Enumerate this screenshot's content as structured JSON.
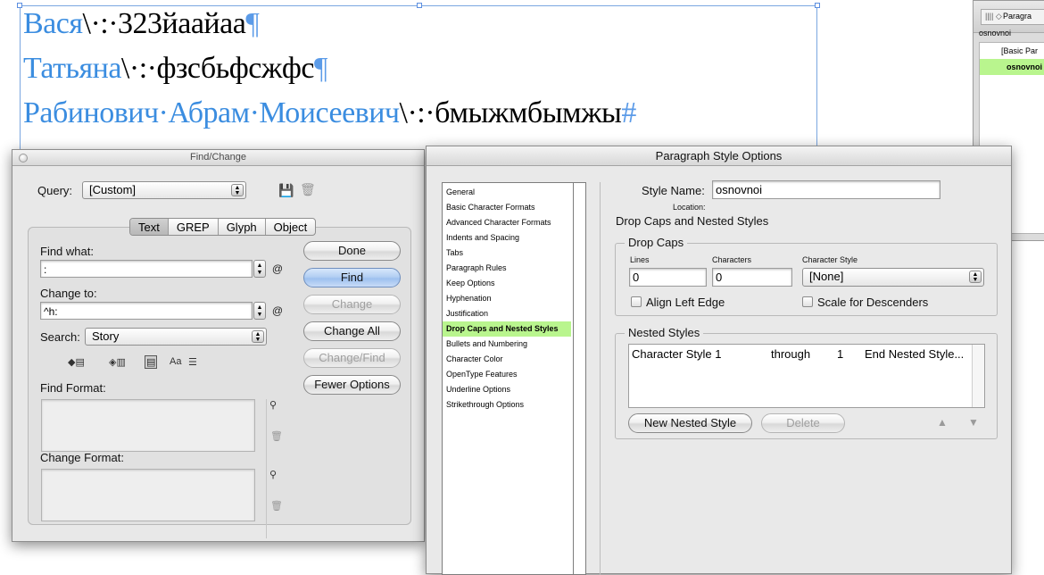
{
  "document": {
    "lines": [
      {
        "name": "Вася",
        "sep": "\\·:·",
        "value": "323йаайаа",
        "mark": "¶"
      },
      {
        "name": "Татьяна",
        "sep": "\\·:·",
        "value": "фзсбьфсжфс",
        "mark": "¶"
      },
      {
        "name": "Рабинович·Абрам·Моисеевич",
        "sep": "\\·:·",
        "value": "бмыжмбымжы",
        "mark": "#"
      }
    ]
  },
  "para_styles_panel": {
    "tab_title": "Paragra",
    "current_style": "osnovnoi",
    "items": [
      "[Basic Par",
      "osnovnoi"
    ]
  },
  "find_change": {
    "title": "Find/Change",
    "query_label": "Query:",
    "query_value": "[Custom]",
    "tabs": [
      "Text",
      "GREP",
      "Glyph",
      "Object"
    ],
    "find_what_label": "Find what:",
    "find_what_value": ":",
    "change_to_label": "Change to:",
    "change_to_value": "^h:",
    "search_label": "Search:",
    "search_value": "Story",
    "find_format_label": "Find Format:",
    "change_format_label": "Change Format:",
    "case_toggle": "Aa",
    "buttons": {
      "done": "Done",
      "find": "Find",
      "change": "Change",
      "change_all": "Change All",
      "change_find": "Change/Find",
      "fewer_options": "Fewer Options"
    }
  },
  "paragraph_style_options": {
    "title": "Paragraph Style Options",
    "categories": [
      "General",
      "Basic Character Formats",
      "Advanced Character Formats",
      "Indents and Spacing",
      "Tabs",
      "Paragraph Rules",
      "Keep Options",
      "Hyphenation",
      "Justification",
      "Drop Caps and Nested Styles",
      "Bullets and Numbering",
      "Character Color",
      "OpenType Features",
      "Underline Options",
      "Strikethrough Options"
    ],
    "selected_category": "Drop Caps and Nested Styles",
    "style_name_label": "Style Name:",
    "style_name_value": "osnovnoi",
    "location_label": "Location:",
    "section_title": "Drop Caps and Nested Styles",
    "drop_caps": {
      "title": "Drop Caps",
      "lines_label": "Lines",
      "lines_value": "0",
      "characters_label": "Characters",
      "characters_value": "0",
      "char_style_label": "Character Style",
      "char_style_value": "[None]",
      "align_left_edge": "Align Left Edge",
      "scale_for_descenders": "Scale for Descenders"
    },
    "nested_styles": {
      "title": "Nested Styles",
      "row": {
        "style": "Character Style 1",
        "through": "through",
        "count": "1",
        "end": "End Nested Style..."
      },
      "new_button": "New Nested Style",
      "delete_button": "Delete"
    }
  }
}
